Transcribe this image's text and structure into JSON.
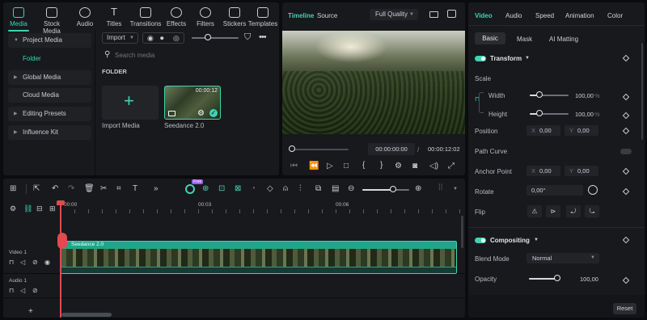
{
  "toolbar": {
    "tools": [
      {
        "label": "Media",
        "icon": "media-icon",
        "active": true
      },
      {
        "label": "Stock Media",
        "icon": "stock-media-icon"
      },
      {
        "label": "Audio",
        "icon": "audio-icon"
      },
      {
        "label": "Titles",
        "icon": "titles-icon"
      },
      {
        "label": "Transitions",
        "icon": "transitions-icon"
      },
      {
        "label": "Effects",
        "icon": "effects-icon"
      },
      {
        "label": "Filters",
        "icon": "filters-icon"
      },
      {
        "label": "Stickers",
        "icon": "stickers-icon"
      },
      {
        "label": "Templates",
        "icon": "templates-icon"
      }
    ]
  },
  "sidebar": {
    "items": [
      {
        "label": "Project Media",
        "expanded": true
      },
      {
        "label": "Folder",
        "active": true
      },
      {
        "label": "Global Media"
      },
      {
        "label": "Cloud Media"
      },
      {
        "label": "Editing Presets"
      },
      {
        "label": "Influence Kit"
      }
    ]
  },
  "media": {
    "import_label": "Import",
    "search_placeholder": "Search media",
    "folder_heading": "FOLDER",
    "import_tile_label": "Import Media",
    "clip_name": "Seedance 2.0",
    "clip_duration": "00:00:12"
  },
  "player": {
    "tab_timeline": "Timeline",
    "tab_source": "Source",
    "quality": "Full Quality",
    "current_time": "00:00:00:00",
    "separator": "/",
    "total_time": "00:00:12:02"
  },
  "timeline": {
    "ruler": [
      "00:00",
      "00:03",
      "00:06"
    ],
    "video_track_label": "Video 1",
    "audio_track_label": "Audio 1",
    "clip_label": "Seedance 2.0",
    "badge": "Free",
    "add_track": "+"
  },
  "inspector": {
    "tabs": [
      "Video",
      "Audio",
      "Speed",
      "Animation",
      "Color"
    ],
    "subtabs": [
      "Basic",
      "Mask",
      "AI Matting"
    ],
    "transform": {
      "title": "Transform",
      "scale_label": "Scale",
      "width_label": "Width",
      "width_value": "100,00",
      "height_label": "Height",
      "height_value": "100,00",
      "percent": "%",
      "position_label": "Position",
      "pos_x_axis": "X",
      "pos_x": "0,00",
      "pos_y_axis": "Y",
      "pos_y": "0,00",
      "path_curve_label": "Path Curve",
      "anchor_label": "Anchor Point",
      "anchor_x_axis": "X",
      "anchor_x": "0,00",
      "anchor_y_axis": "Y",
      "anchor_y": "0,00",
      "rotate_label": "Rotate",
      "rotate_value": "0,00°",
      "flip_label": "Flip",
      "width_level": 1.0,
      "height_level": 1.0
    },
    "compositing": {
      "title": "Compositing",
      "blend_label": "Blend Mode",
      "blend_value": "Normal",
      "opacity_label": "Opacity",
      "opacity_value": "100,00",
      "opacity_level": 1.0
    },
    "reset_label": "Reset"
  },
  "colors": {
    "accent": "#3fd3b6",
    "panel": "#18191c",
    "clip": "#1fa58a",
    "playhead": "#e5484d"
  }
}
